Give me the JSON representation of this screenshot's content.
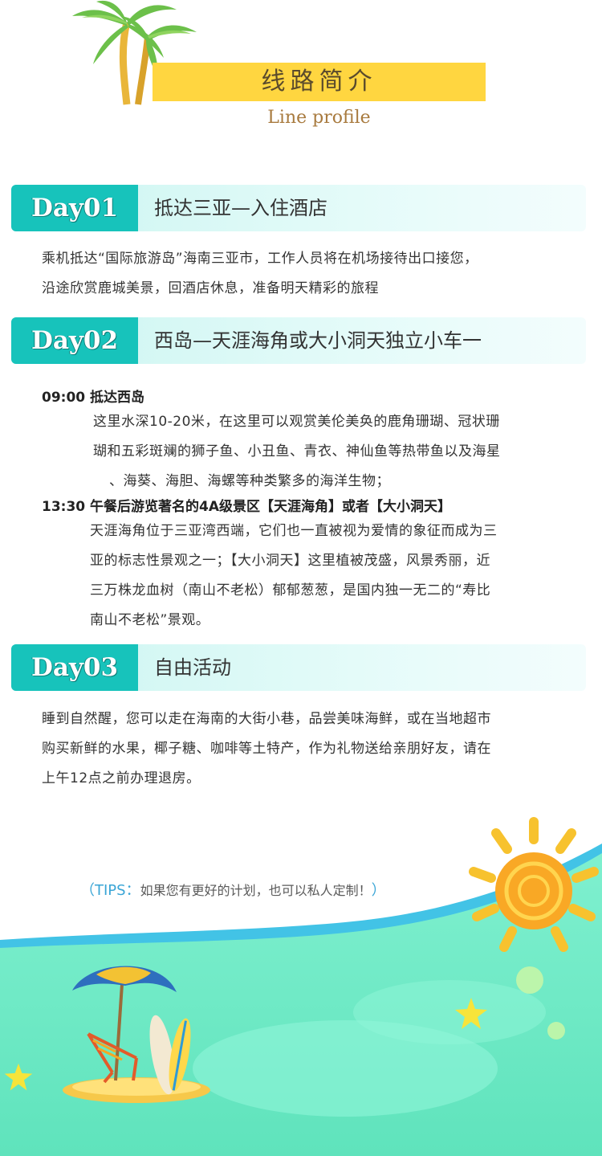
{
  "header": {
    "title": "线路简介",
    "subtitle": "Line profile"
  },
  "days": [
    {
      "label": "Day01",
      "title": "抵达三亚—入住酒店",
      "lines": [
        "乘机抵达“国际旅游岛”海南三亚市，工作人员将在机场接待出口接您，",
        "沿途欣赏鹿城美景，回酒店休息，准备明天精彩的旅程"
      ]
    },
    {
      "label": "Day02",
      "title": "西岛—天涯海角或大小洞天独立小车一",
      "sections": [
        {
          "time": "09:00 抵达西岛",
          "lines": [
            "这里水深10-20米，在这里可以观赏美伦美奂的鹿角珊瑚、冠状珊",
            "瑚和五彩斑斓的狮子鱼、小丑鱼、青衣、神仙鱼等热带鱼以及海星",
            "、海葵、海胆、海螺等种类繁多的海洋生物；"
          ]
        },
        {
          "time": "13:30 午餐后游览著名的4A级景区【天涯海角】或者【大小洞天】",
          "lines": [
            "天涯海角位于三亚湾西端，它们也一直被视为爱情的象征而成为三",
            "亚的标志性景观之一；【大小洞天】这里植被茂盛，风景秀丽，近",
            "三万株龙血树（南山不老松）郁郁葱葱，是国内独一无二的“寿比",
            "南山不老松”景观。"
          ]
        }
      ]
    },
    {
      "label": "Day03",
      "title": "自由活动",
      "lines": [
        "睡到自然醒，您可以走在海南的大街小巷，品尝美味海鲜，或在当地超市",
        "购买新鲜的水果，椰子糖、咖啡等土特产，作为礼物送给亲朋好友，请在",
        "上午12点之前办理退房。"
      ]
    }
  ],
  "tips": {
    "open": "（",
    "label": "TIPS：",
    "text": "如果您有更好的计划，也可以私人定制！",
    "close": "）"
  },
  "colors": {
    "accent_teal": "#17c3bb",
    "title_yellow": "#ffd640",
    "sea_green": "#6fe8c6",
    "sun_orange": "#f7a51e"
  },
  "icons": [
    "palm-tree-icon",
    "sun-icon",
    "beach-umbrella-icon",
    "surfboard-icon",
    "star-icon",
    "bubble-icon"
  ]
}
